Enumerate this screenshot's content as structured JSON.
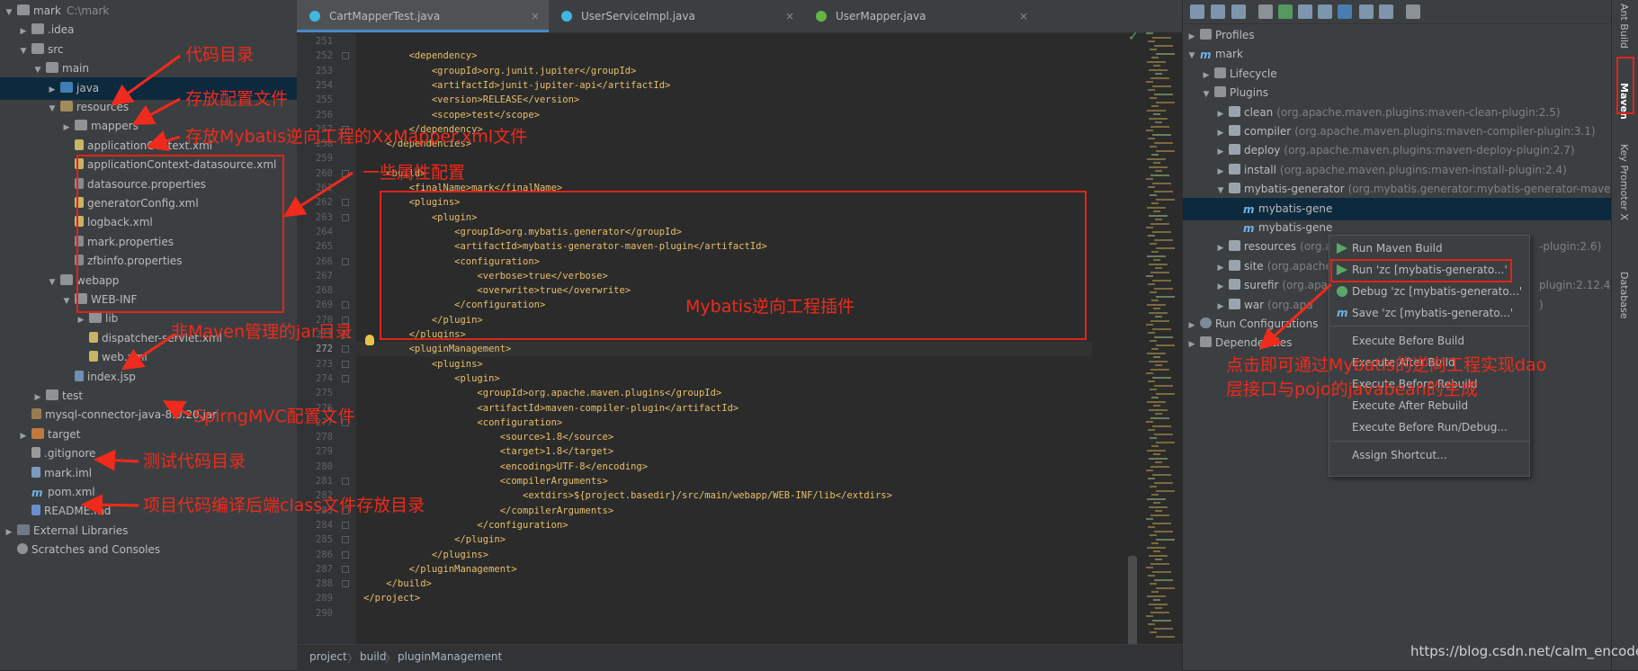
{
  "project": {
    "items": [
      {
        "label": "mark",
        "path": "C:\\mark",
        "arrow": "▼",
        "icon": "folder-icon"
      },
      {
        "label": ".idea",
        "arrow": "▶",
        "icon": "folder-icon"
      },
      {
        "label": "src",
        "arrow": "▼",
        "icon": "folder-icon"
      },
      {
        "label": "main",
        "arrow": "▼",
        "icon": "folder-icon"
      },
      {
        "label": "java",
        "arrow": "▶",
        "icon": "source-folder-icon",
        "selected": true
      },
      {
        "label": "resources",
        "arrow": "▼",
        "icon": "resources-folder-icon"
      },
      {
        "label": "mappers",
        "arrow": "▶",
        "icon": "folder-icon"
      },
      {
        "label": "applicationContext.xml",
        "icon": "xml-file-icon"
      },
      {
        "label": "applicationContext-datasource.xml",
        "icon": "xml-file-icon"
      },
      {
        "label": "datasource.properties",
        "icon": "properties-file-icon"
      },
      {
        "label": "generatorConfig.xml",
        "icon": "xml-file-icon"
      },
      {
        "label": "logback.xml",
        "icon": "xml-file-icon"
      },
      {
        "label": "mark.properties",
        "icon": "properties-file-icon"
      },
      {
        "label": "zfbinfo.properties",
        "icon": "properties-file-icon"
      },
      {
        "label": "webapp",
        "arrow": "▼",
        "icon": "folder-icon"
      },
      {
        "label": "WEB-INF",
        "arrow": "▼",
        "icon": "folder-icon"
      },
      {
        "label": "lib",
        "arrow": "▶",
        "icon": "folder-icon"
      },
      {
        "label": "dispatcher-servlet.xml",
        "icon": "xml-file-icon"
      },
      {
        "label": "web.xml",
        "icon": "xml-file-icon"
      },
      {
        "label": "index.jsp",
        "icon": "jsp-file-icon"
      },
      {
        "label": "test",
        "arrow": "▶",
        "icon": "folder-icon"
      },
      {
        "label": "mysql-connector-java-8.0.20.jar",
        "icon": "jar-file-icon"
      },
      {
        "label": "target",
        "arrow": "▶",
        "icon": "excluded-folder-icon"
      },
      {
        "label": ".gitignore",
        "icon": "text-file-icon"
      },
      {
        "label": "mark.iml",
        "icon": "iml-file-icon"
      },
      {
        "label": "pom.xml",
        "icon": "maven-icon"
      },
      {
        "label": "README.md",
        "icon": "markdown-file-icon"
      },
      {
        "label": "External Libraries",
        "arrow": "▶",
        "icon": "library-icon"
      },
      {
        "label": "Scratches and Consoles",
        "arrow": "",
        "icon": "scratch-icon"
      }
    ]
  },
  "editor": {
    "tabs": [
      {
        "label": "CartMapperTest.java",
        "active": true,
        "color": "#40b6e0"
      },
      {
        "label": "UserServiceImpl.java",
        "active": false,
        "color": "#40b6e0"
      },
      {
        "label": "UserMapper.java",
        "active": false,
        "color": "#62b543"
      }
    ],
    "close_glyph": "×",
    "check_glyph": "✓",
    "lines": [
      {
        "n": "251",
        "code": ""
      },
      {
        "n": "252",
        "code": "        <dependency>"
      },
      {
        "n": "253",
        "code": "            <groupId>org.junit.jupiter</groupId>"
      },
      {
        "n": "254",
        "code": "            <artifactId>junit-jupiter-api</artifactId>"
      },
      {
        "n": "255",
        "code": "            <version>RELEASE</version>"
      },
      {
        "n": "256",
        "code": "            <scope>test</scope>"
      },
      {
        "n": "257",
        "code": "        </dependency>"
      },
      {
        "n": "258",
        "code": "    </dependencies>"
      },
      {
        "n": "259",
        "code": ""
      },
      {
        "n": "260",
        "code": "    <build>"
      },
      {
        "n": "261",
        "code": "        <finalName>mark</finalName>"
      },
      {
        "n": "262",
        "code": "        <plugins>"
      },
      {
        "n": "263",
        "code": "            <plugin>"
      },
      {
        "n": "264",
        "code": "                <groupId>org.mybatis.generator</groupId>"
      },
      {
        "n": "265",
        "code": "                <artifactId>mybatis-generator-maven-plugin</artifactId>"
      },
      {
        "n": "266",
        "code": "                <configuration>"
      },
      {
        "n": "267",
        "code": "                    <verbose>true</verbose>"
      },
      {
        "n": "268",
        "code": "                    <overwrite>true</overwrite>"
      },
      {
        "n": "269",
        "code": "                </configuration>"
      },
      {
        "n": "270",
        "code": "            </plugin>"
      },
      {
        "n": "271",
        "code": "        </plugins>"
      },
      {
        "n": "272",
        "code": "        <pluginManagement>",
        "highlight": true
      },
      {
        "n": "273",
        "code": "            <plugins>"
      },
      {
        "n": "274",
        "code": "                <plugin>"
      },
      {
        "n": "275",
        "code": "                    <groupId>org.apache.maven.plugins</groupId>"
      },
      {
        "n": "276",
        "code": "                    <artifactId>maven-compiler-plugin</artifactId>"
      },
      {
        "n": "277",
        "code": "                    <configuration>"
      },
      {
        "n": "278",
        "code": "                        <source>1.8</source>"
      },
      {
        "n": "279",
        "code": "                        <target>1.8</target>"
      },
      {
        "n": "280",
        "code": "                        <encoding>UTF-8</encoding>"
      },
      {
        "n": "281",
        "code": "                        <compilerArguments>"
      },
      {
        "n": "282",
        "code": "                            <extdirs>${project.basedir}/src/main/webapp/WEB-INF/lib</extdirs>"
      },
      {
        "n": "283",
        "code": "                        </compilerArguments>"
      },
      {
        "n": "284",
        "code": "                    </configuration>"
      },
      {
        "n": "285",
        "code": "                </plugin>"
      },
      {
        "n": "286",
        "code": "            </plugins>"
      },
      {
        "n": "287",
        "code": "        </pluginManagement>"
      },
      {
        "n": "288",
        "code": "    </build>"
      },
      {
        "n": "289",
        "code": "</project>"
      },
      {
        "n": "290",
        "code": ""
      }
    ],
    "breadcrumb": [
      "project",
      "build",
      "pluginManagement"
    ],
    "breadcrumb_sep": "〉"
  },
  "maven": {
    "toolbar": [
      "refresh-icon",
      "reimport-icon",
      "download-icon",
      "add-icon",
      "run-icon",
      "toggle-offline-icon",
      "skip-tests-icon",
      "show-dependencies-icon",
      "collapse-icon",
      "expand-icon",
      "settings-icon"
    ],
    "items": [
      {
        "label": "Profiles",
        "arrow": "▶",
        "icon": "folder-icon"
      },
      {
        "label": "mark",
        "arrow": "▼",
        "icon": "maven-project-icon"
      },
      {
        "label": "Lifecycle",
        "arrow": "▶",
        "icon": "folder-icon"
      },
      {
        "label": "Plugins",
        "arrow": "▼",
        "icon": "folder-icon"
      },
      {
        "label": "clean",
        "gray": "(org.apache.maven.plugins:maven-clean-plugin:2.5)",
        "arrow": "▶",
        "icon": "plugin-icon"
      },
      {
        "label": "compiler",
        "gray": "(org.apache.maven.plugins:maven-compiler-plugin:3.1)",
        "arrow": "▶",
        "icon": "plugin-icon"
      },
      {
        "label": "deploy",
        "gray": "(org.apache.maven.plugins:maven-deploy-plugin:2.7)",
        "arrow": "▶",
        "icon": "plugin-icon"
      },
      {
        "label": "install",
        "gray": "(org.apache.maven.plugins:maven-install-plugin:2.4)",
        "arrow": "▶",
        "icon": "plugin-icon"
      },
      {
        "label": "mybatis-generator",
        "gray": "(org.mybatis.generator:mybatis-generator-maven-",
        "arrow": "▼",
        "icon": "plugin-icon"
      },
      {
        "label": "mybatis-gene",
        "arrow": "",
        "icon": "goal-icon",
        "selected": true
      },
      {
        "label": "mybatis-gene",
        "arrow": "",
        "icon": "goal-icon"
      },
      {
        "label": "resources",
        "gray": "(org.apache",
        "gray_tail": "-plugin:2.6)",
        "arrow": "▶",
        "icon": "plugin-icon"
      },
      {
        "label": "site",
        "gray": "(org.apache",
        "arrow": "▶",
        "icon": "plugin-icon"
      },
      {
        "label": "surefir",
        "gray": "(org.apa",
        "gray_tail": "plugin:2.12.4)",
        "arrow": "▶",
        "icon": "plugin-icon"
      },
      {
        "label": "war",
        "gray": "(org.apa",
        "gray_tail": ")",
        "arrow": "▶",
        "icon": "plugin-icon"
      },
      {
        "label": "Run Configurations",
        "arrow": "▶",
        "icon": "gear-icon"
      },
      {
        "label": "Dependencies",
        "arrow": "▶",
        "icon": "folder-icon"
      }
    ]
  },
  "context_menu": {
    "items": [
      {
        "label": "Run Maven Build",
        "icon": "run-icon",
        "mnemonic": "R"
      },
      {
        "label": "Run 'zc [mybatis-generato...'",
        "icon": "run-icon"
      },
      {
        "label": "Debug 'zc [mybatis-generato...'",
        "icon": "debug-icon"
      },
      {
        "label": "Save 'zc [mybatis-generato...'",
        "icon": "maven-icon"
      },
      {
        "label": "Execute Before Build"
      },
      {
        "label": "Execute After Build"
      },
      {
        "label": "Execute Before Rebuild"
      },
      {
        "label": "Execute After Rebuild"
      },
      {
        "label": "Execute Before Run/Debug..."
      },
      {
        "label": "Assign Shortcut..."
      }
    ]
  },
  "right_strip": {
    "ant_build": "Ant Build",
    "maven": "Maven",
    "key_promoter": "Key Promoter X",
    "database": "Database"
  },
  "annotations": {
    "code_dir": "代码目录",
    "config_files": "存放配置文件",
    "mapper_dir": "存放Mybatis逆向工程的XxMapper.xml文件",
    "properties": "一些属性配置",
    "plugin": "Mybatis逆向工程插件",
    "jar_dir": "非Maven管理的jar目录",
    "springmvc": "SpirngMVC配置文件",
    "test_dir": "测试代码目录",
    "class_dir": "项目代码编译后端class文件存放目录",
    "click_hint_line1": "点击即可通过Mybatis的逆向工程实现dao",
    "click_hint_line2": "层接口与pojo的javabean的生成"
  },
  "watermark": "https://blog.csdn.net/calm_encode",
  "colors": {
    "annotation_red": "#f02a1c",
    "selection": "#0d293e",
    "tag": "#e8bf6a",
    "text": "#a9b7c6"
  }
}
